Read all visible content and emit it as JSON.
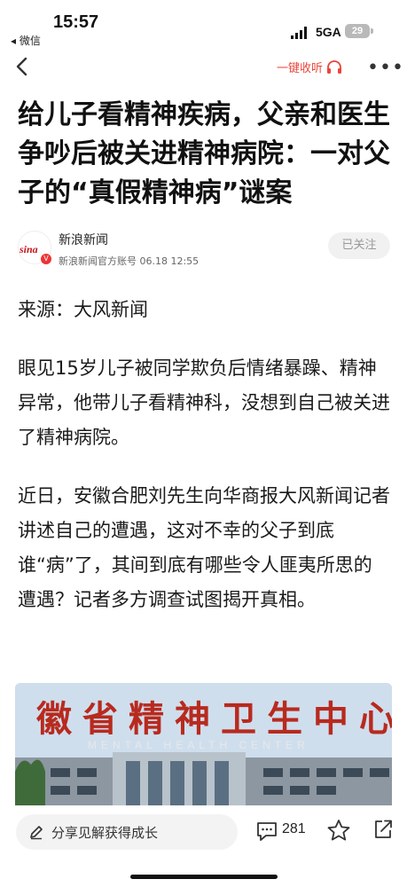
{
  "status_bar": {
    "time": "15:57",
    "back_app": "◂ 微信",
    "network": "5GA",
    "battery": "29"
  },
  "nav": {
    "listen_label": "一键收听"
  },
  "article": {
    "title": "给儿子看精神疾病，父亲和医生争吵后被关进精神病院：一对父子的“真假精神病”谜案",
    "author": {
      "avatar_text": "sina",
      "name": "新浪新闻",
      "meta": "新浪新闻官方账号  06.18  12:55",
      "follow_label": "已关注"
    },
    "paragraphs": [
      "来源：大风新闻",
      "眼见15岁儿子被同学欺负后情绪暴躁、精神异常，他带儿子看精神科，没想到自己被关进了精神病院。",
      "近日，安徽合肥刘先生向华商报大风新闻记者讲述自己的遭遇，这对不幸的父子到底谁“病”了，其间到底有哪些令人匪夷所思的遭遇？记者多方调查试图揭开真相。"
    ],
    "image": {
      "sign_text": "徽省精神卫生中心",
      "sign_en": "MENTAL HEALTH CENTER"
    }
  },
  "bottom_bar": {
    "share_prompt": "分享见解获得成长",
    "comment_count": "281"
  },
  "colors": {
    "accent": "#e8463c",
    "brand_red": "#c8161d",
    "text": "#1b1b1b"
  }
}
